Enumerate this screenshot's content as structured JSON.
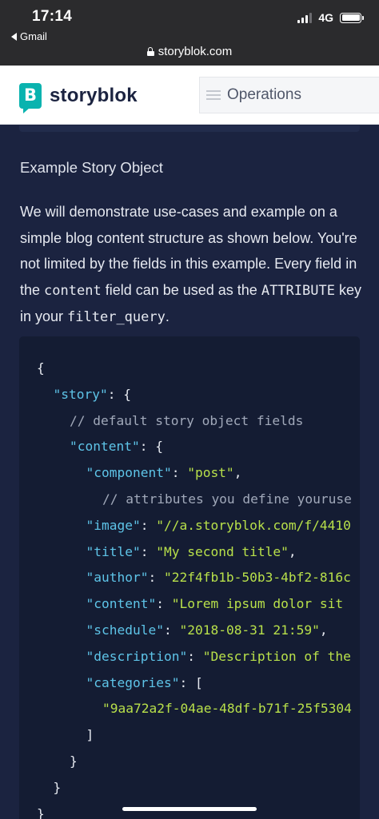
{
  "status_bar": {
    "time": "17:14",
    "back_app": "Gmail",
    "network": "4G"
  },
  "browser": {
    "url": "storyblok.com"
  },
  "header": {
    "logo_letter": "B",
    "logo_text": "storyblok",
    "menu_label": "Operations"
  },
  "content": {
    "section_title": "Example Story Object",
    "paragraph": {
      "part1": "We will demonstrate use-cases and example on a simple blog content structure as shown below. You're not limited by the fields in this example. Every field in the ",
      "code1": "content",
      "part2": " field can be used as the ",
      "code2": "ATTRIBUTE",
      "part3": " key in your ",
      "code3": "filter_query",
      "part4": "."
    },
    "code_lines": [
      {
        "indent": 0,
        "tokens": [
          {
            "t": "punc",
            "v": "{"
          }
        ]
      },
      {
        "indent": 1,
        "tokens": [
          {
            "t": "key",
            "v": "\"story\""
          },
          {
            "t": "punc",
            "v": ": {"
          }
        ]
      },
      {
        "indent": 2,
        "tokens": [
          {
            "t": "comment",
            "v": "// default story object fields"
          }
        ]
      },
      {
        "indent": 2,
        "tokens": [
          {
            "t": "key",
            "v": "\"content\""
          },
          {
            "t": "punc",
            "v": ": {"
          }
        ]
      },
      {
        "indent": 3,
        "tokens": [
          {
            "t": "key",
            "v": "\"component\""
          },
          {
            "t": "punc",
            "v": ": "
          },
          {
            "t": "str",
            "v": "\"post\""
          },
          {
            "t": "punc",
            "v": ","
          }
        ]
      },
      {
        "indent": 4,
        "tokens": [
          {
            "t": "comment",
            "v": "// attributes you define youruse"
          }
        ]
      },
      {
        "indent": 3,
        "tokens": [
          {
            "t": "key",
            "v": "\"image\""
          },
          {
            "t": "punc",
            "v": ": "
          },
          {
            "t": "str",
            "v": "\"//a.storyblok.com/f/4410"
          }
        ]
      },
      {
        "indent": 3,
        "tokens": [
          {
            "t": "key",
            "v": "\"title\""
          },
          {
            "t": "punc",
            "v": ": "
          },
          {
            "t": "str",
            "v": "\"My second title\""
          },
          {
            "t": "punc",
            "v": ","
          }
        ]
      },
      {
        "indent": 3,
        "tokens": [
          {
            "t": "key",
            "v": "\"author\""
          },
          {
            "t": "punc",
            "v": ": "
          },
          {
            "t": "str",
            "v": "\"22f4fb1b-50b3-4bf2-816c"
          }
        ]
      },
      {
        "indent": 3,
        "tokens": [
          {
            "t": "key",
            "v": "\"content\""
          },
          {
            "t": "punc",
            "v": ": "
          },
          {
            "t": "str",
            "v": "\"Lorem ipsum dolor sit"
          }
        ]
      },
      {
        "indent": 3,
        "tokens": [
          {
            "t": "key",
            "v": "\"schedule\""
          },
          {
            "t": "punc",
            "v": ": "
          },
          {
            "t": "str",
            "v": "\"2018-08-31 21:59\""
          },
          {
            "t": "punc",
            "v": ","
          }
        ]
      },
      {
        "indent": 3,
        "tokens": [
          {
            "t": "key",
            "v": "\"description\""
          },
          {
            "t": "punc",
            "v": ": "
          },
          {
            "t": "str",
            "v": "\"Description of the"
          }
        ]
      },
      {
        "indent": 3,
        "tokens": [
          {
            "t": "key",
            "v": "\"categories\""
          },
          {
            "t": "punc",
            "v": ": ["
          }
        ]
      },
      {
        "indent": 4,
        "tokens": [
          {
            "t": "str",
            "v": "\"9aa72a2f-04ae-48df-b71f-25f5304"
          }
        ]
      },
      {
        "indent": 3,
        "tokens": [
          {
            "t": "punc",
            "v": "]"
          }
        ]
      },
      {
        "indent": 2,
        "tokens": [
          {
            "t": "punc",
            "v": "}"
          }
        ]
      },
      {
        "indent": 1,
        "tokens": [
          {
            "t": "punc",
            "v": "}"
          }
        ]
      },
      {
        "indent": 0,
        "tokens": [
          {
            "t": "punc",
            "v": "}"
          }
        ]
      }
    ]
  },
  "colors": {
    "page_bg": "#1b2340",
    "code_bg": "#141c33",
    "code_key": "#5ec4e8",
    "code_string": "#b8e04a",
    "brand": "#0ab3af"
  }
}
